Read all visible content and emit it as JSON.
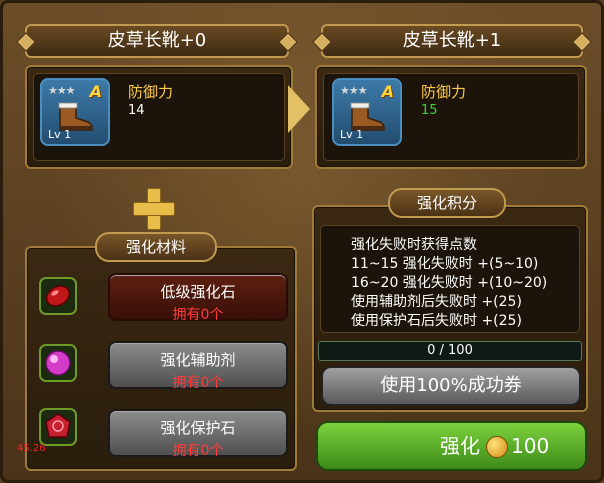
{
  "left_item": {
    "title": "皮草长靴+0",
    "grade": "A",
    "level": "Lv 1",
    "stat_label": "防御力",
    "stat_value": "14"
  },
  "right_item": {
    "title": "皮草长靴+1",
    "grade": "A",
    "level": "Lv 1",
    "stat_label": "防御力",
    "stat_value": "15",
    "stat_value_color": "#39d639"
  },
  "materials": {
    "title": "强化材料",
    "items": [
      {
        "name": "低级强化石",
        "count": "拥有0个",
        "icon": "red-gem-icon"
      },
      {
        "name": "强化辅助剂",
        "count": "拥有0个",
        "icon": "pink-orb-icon"
      },
      {
        "name": "强化保护石",
        "count": "拥有0个",
        "icon": "red-rose-stone-icon"
      }
    ]
  },
  "score": {
    "title": "强化积分",
    "lines": [
      "强化失败时获得点数",
      "11~15 强化失败时 +(5~10)",
      "16~20 强化失败时 +(10~20)",
      "使用辅助剂后失败时 +(25)",
      "使用保护石后失败时 +(25)"
    ],
    "progress_text": "0 / 100",
    "progress_fraction": 0
  },
  "buttons": {
    "success_100": "使用100%成功券",
    "enhance_label": "强化",
    "enhance_cost": "100"
  },
  "corner_text": "45.26",
  "colors": {
    "gold": "#e2c065",
    "stat_label": "#ffcc4a",
    "count_red": "#ff3b3b",
    "enhance_green": "#5cb52a"
  }
}
